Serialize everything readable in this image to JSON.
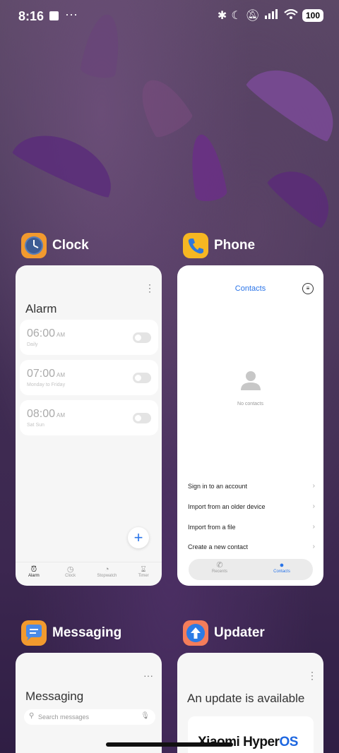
{
  "status_bar": {
    "time": "8:16",
    "more": "···",
    "icons": [
      "bluetooth-icon",
      "moon-icon",
      "bell-off-icon",
      "signal-icon",
      "wifi-icon"
    ],
    "battery": "100"
  },
  "apps": {
    "clock": {
      "name": "Clock",
      "title": "Alarm",
      "alarms": [
        {
          "time": "06:00",
          "ampm": "AM",
          "days": "Daily"
        },
        {
          "time": "07:00",
          "ampm": "AM",
          "days": "Monday to Friday"
        },
        {
          "time": "08:00",
          "ampm": "AM",
          "days": "Sat Sun"
        }
      ],
      "tabs": [
        "Alarm",
        "Clock",
        "Stopwatch",
        "Timer"
      ]
    },
    "phone": {
      "name": "Phone",
      "title": "Contacts",
      "empty": "No contacts",
      "rows": [
        "Sign in to an account",
        "Import from an older device",
        "Import from a file",
        "Create a new contact"
      ],
      "tabs": [
        "Recents",
        "Contacts"
      ]
    },
    "messaging": {
      "name": "Messaging",
      "title": "Messaging",
      "search_placeholder": "Search messages"
    },
    "updater": {
      "name": "Updater",
      "title": "An update is available",
      "brand_a": "Xiaomi Hyper",
      "brand_b": "OS"
    }
  },
  "colors": {
    "accent": "#2a74e8"
  }
}
